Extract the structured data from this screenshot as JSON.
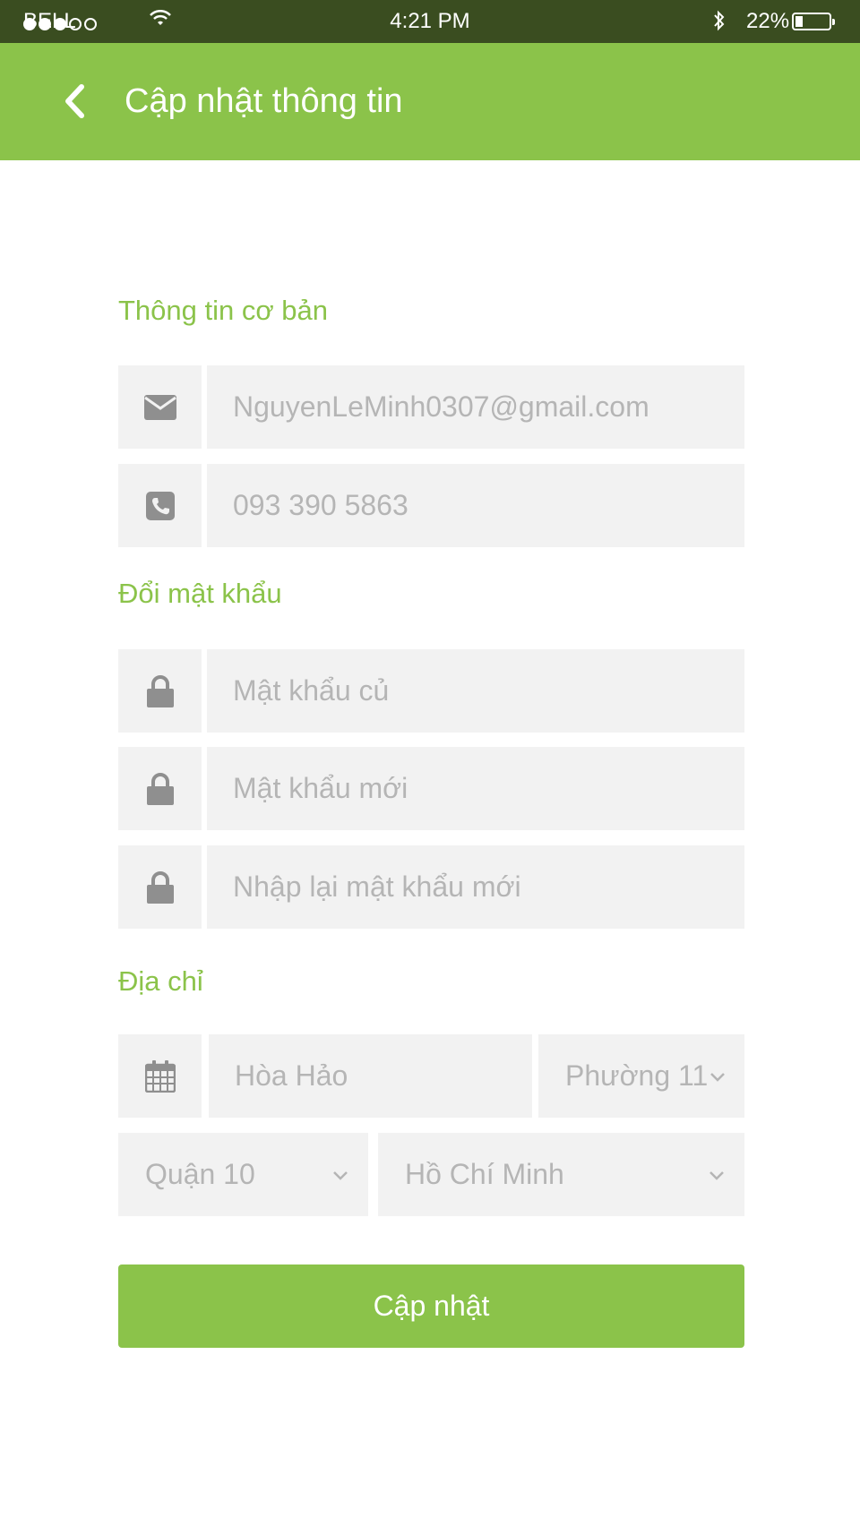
{
  "status_bar": {
    "carrier": "BELL",
    "time": "4:21 PM",
    "battery": "22%",
    "battery_level": 0.22,
    "signal_bars_filled": 3,
    "signal_bars_total": 5
  },
  "header": {
    "title": "Cập nhật thông tin",
    "background_color": "#8bc34a"
  },
  "sections": {
    "basic_info": "Thông tin cơ bản",
    "change_password": "Đổi mật khẩu",
    "address": "Địa chỉ"
  },
  "fields": {
    "email": {
      "value": "NguyenLeMinh0307@gmail.com",
      "icon": "envelope-icon"
    },
    "phone": {
      "value": "093 390 5863",
      "icon": "phone-icon"
    },
    "old_password": {
      "placeholder": "Mật khẩu củ",
      "icon": "lock-icon"
    },
    "new_password": {
      "placeholder": "Mật khẩu mới",
      "icon": "lock-icon"
    },
    "confirm_password": {
      "placeholder": "Nhập lại mật khẩu mới",
      "icon": "lock-icon"
    },
    "street": {
      "value": "Hòa Hảo",
      "icon": "calendar-icon"
    },
    "ward": {
      "value": "Phường 11"
    },
    "district": {
      "value": "Quận 10"
    },
    "city": {
      "value": "Hồ Chí Minh"
    }
  },
  "submit_label": "Cập nhật",
  "colors": {
    "accent": "#8bc34a",
    "status_bar": "#3a4d20",
    "field_bg": "#f2f2f2",
    "placeholder": "#b5b5b5",
    "icon": "#8f8f8f"
  }
}
